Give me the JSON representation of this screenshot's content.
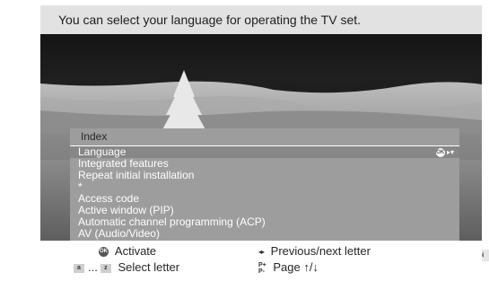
{
  "banner": {
    "text": "You can select your language for operating the TV set."
  },
  "menu": {
    "title": "Index",
    "selected_hint": {
      "icon": "ok-icon",
      "badge_text": "OK",
      "arrows": "▸▾"
    },
    "items": [
      {
        "label": "Language",
        "selected": true
      },
      {
        "label": "Integrated features"
      },
      {
        "label": "Repeat initial installation"
      },
      {
        "label": "*"
      },
      {
        "label": "Access code"
      },
      {
        "label": "Active window (PIP)"
      },
      {
        "label": "Automatic channel programming (ACP)"
      },
      {
        "label": "AV (Audio/Video)"
      }
    ]
  },
  "lang_tag": "EN",
  "hints": {
    "activate": {
      "icon": "ok-button-icon",
      "badge": "OK",
      "label": "Activate"
    },
    "select_letter": {
      "icon": "letter-keys-icon",
      "badge_from": "a",
      "separator": "...",
      "badge_to": "z",
      "label": "Select letter"
    },
    "prev_next": {
      "icon": "left-right-arrows-icon",
      "glyph": "◂▸",
      "label": "Previous/next letter"
    },
    "page": {
      "icon": "page-up-down-icon",
      "glyph_top": "P+",
      "glyph_bottom": "P-",
      "label": "Page ↑/↓"
    }
  },
  "colors": {
    "banner_bg": "#e2e2e2",
    "menu_bg": "#9d9d9d",
    "selected_bg": "#878787",
    "text_dark": "#262626",
    "text_light": "#ffffff"
  }
}
